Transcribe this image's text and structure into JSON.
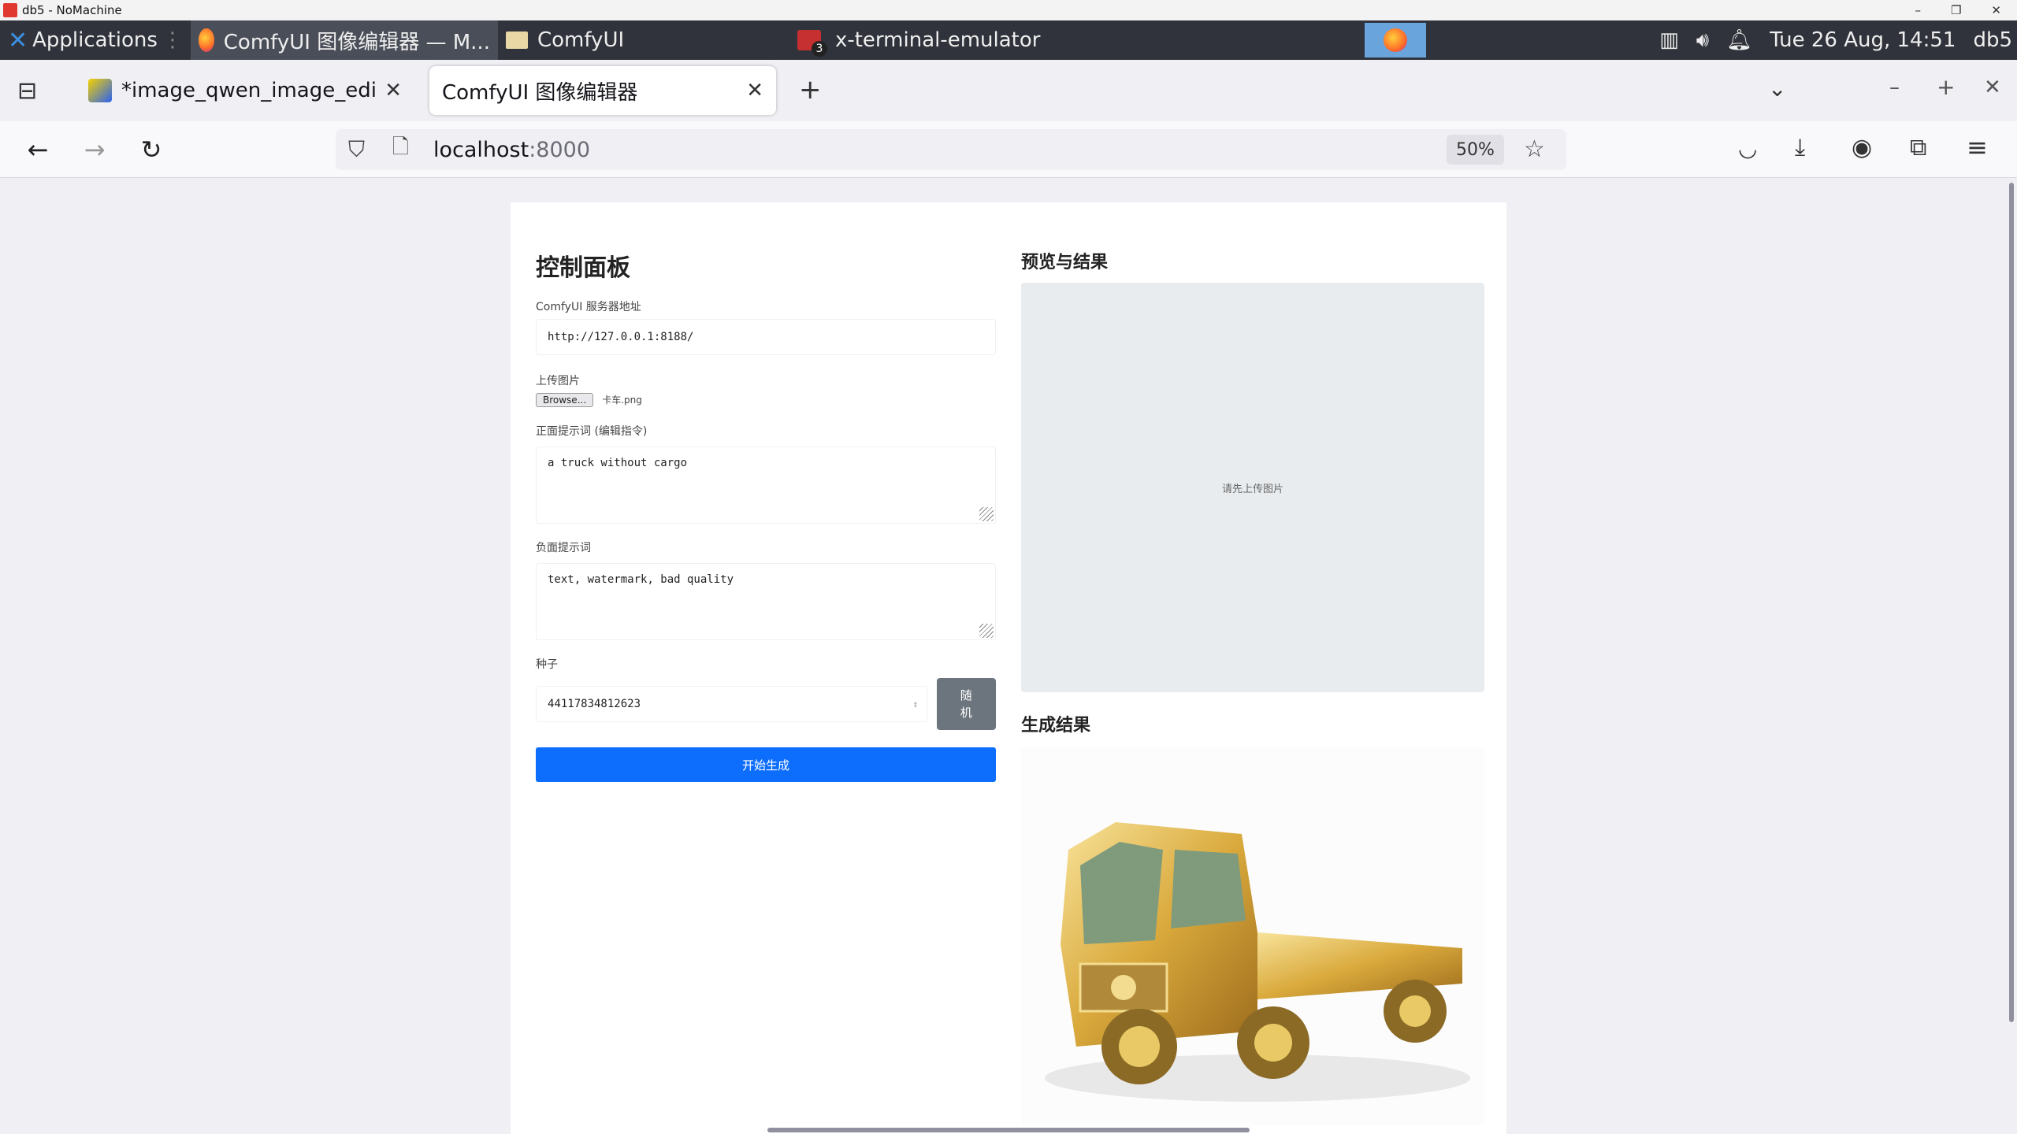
{
  "nomachine": {
    "title": "db5 - NoMachine"
  },
  "panel": {
    "apps_label": "Applications",
    "tasks": [
      {
        "label": "ComfyUI 图像编辑器 — M..."
      },
      {
        "label": "ComfyUI"
      },
      {
        "label": "x-terminal-emulator",
        "badge": "3"
      }
    ],
    "clock": "Tue 26 Aug, 14:51",
    "host": "db5"
  },
  "browser": {
    "tabs": [
      {
        "label": "*image_qwen_image_edi",
        "active": false
      },
      {
        "label": "ComfyUI 图像编辑器",
        "active": true
      }
    ],
    "url_host": "localhost",
    "url_port": ":8000",
    "zoom": "50%"
  },
  "app": {
    "panel_title": "控制面板",
    "server_label": "ComfyUI 服务器地址",
    "server_value": "http://127.0.0.1:8188/",
    "upload_label": "上传图片",
    "browse_label": "Browse...",
    "file_name": "卡车.png",
    "positive_label": "正面提示词 (编辑指令)",
    "positive_value": "a truck without cargo",
    "negative_label": "负面提示词",
    "negative_value": "text, watermark, bad quality",
    "seed_label": "种子",
    "seed_value": "441178348126​23",
    "random_label": "随机",
    "generate_label": "开始生成",
    "preview_heading": "预览与结果",
    "preview_placeholder": "请先上传图片",
    "result_heading": "生成结果"
  }
}
